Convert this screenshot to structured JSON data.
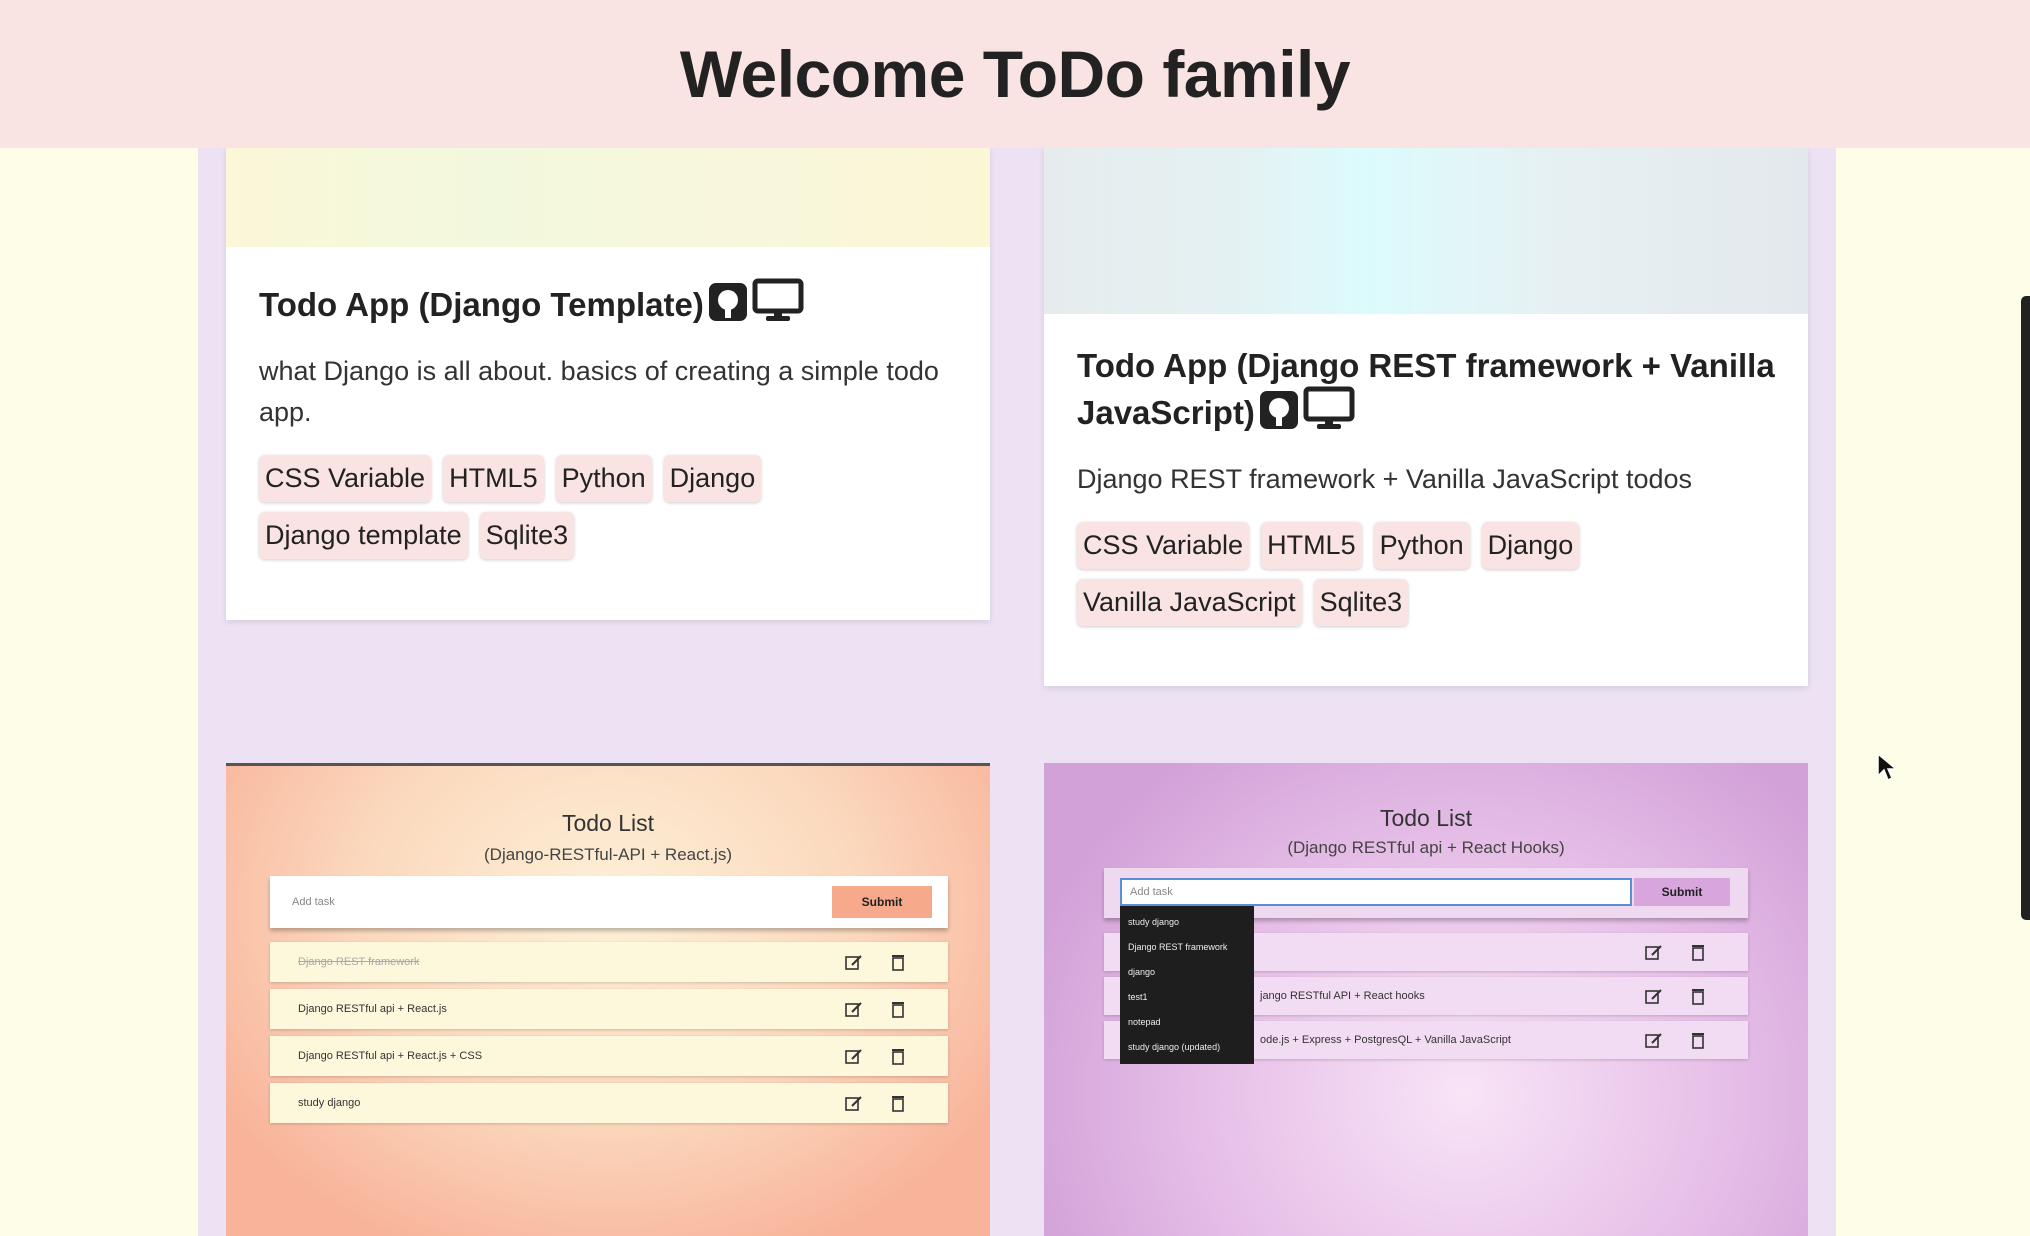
{
  "header": {
    "title": "Welcome ToDo family"
  },
  "cards": [
    {
      "title": "Todo App (Django Template)",
      "description": "what Django is all about. basics of creating a simple todo app.",
      "tags": [
        "CSS Variable",
        "HTML5",
        "Python",
        "Django",
        "Django template",
        "Sqlite3"
      ],
      "icons": [
        "github-icon",
        "desktop-icon"
      ]
    },
    {
      "title": "Todo App (Django REST framework + Vanilla JavaScript)",
      "description": "Django REST framework + Vanilla JavaScript todos",
      "tags": [
        "CSS Variable",
        "HTML5",
        "Python",
        "Django",
        "Vanilla JavaScript",
        "Sqlite3"
      ],
      "icons": [
        "github-icon",
        "desktop-icon"
      ]
    }
  ],
  "previews": [
    {
      "title": "Todo List",
      "subtitle": "(Django-RESTful-API + React.js)",
      "input_placeholder": "Add task",
      "submit_label": "Submit",
      "rows": [
        "Django REST framework",
        "Django RESTful api + React.js",
        "Django RESTful api + React.js + CSS",
        "study django"
      ]
    },
    {
      "title": "Todo List",
      "subtitle": "(Django RESTful api + React Hooks)",
      "input_placeholder": "Add task",
      "submit_label": "Submit",
      "rows": [
        "",
        "jango RESTful API + React hooks",
        "ode.js + Express + PostgresQL + Vanilla JavaScript"
      ],
      "dropdown": [
        "study django",
        "Django REST framework",
        "django",
        "test1",
        "notepad",
        "study django (updated)"
      ]
    }
  ],
  "colors": {
    "header_bg": "#f9e3e3",
    "page_bg": "#fdfde8",
    "main_bg": "#ece2f3",
    "tag_bg": "#f9e3e3"
  }
}
